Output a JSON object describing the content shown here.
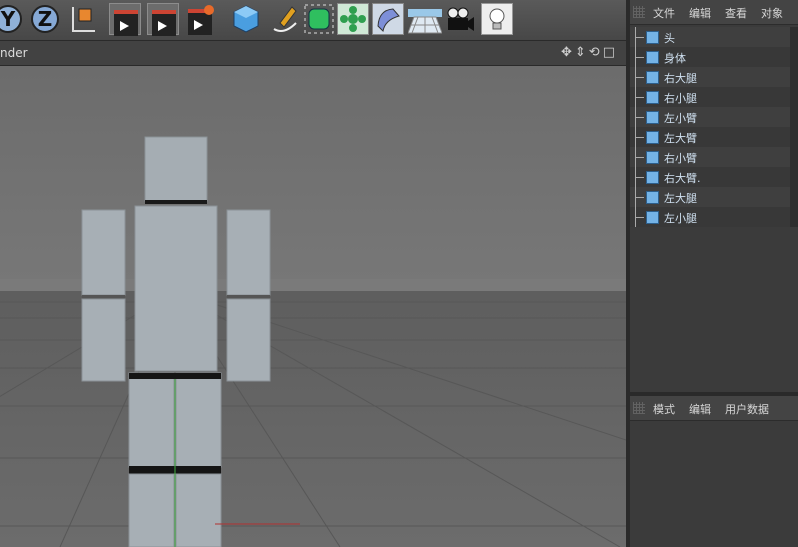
{
  "toolbar": {
    "axis_buttons": [
      {
        "label": "Y"
      },
      {
        "label": "Z"
      }
    ],
    "tools": [
      "coordinate-system-icon",
      "render-view-icon",
      "render-picture-viewer-icon",
      "render-settings-icon",
      "cube-object-icon",
      "spline-pen-icon",
      "subdivision-surface-icon",
      "array-icon",
      "deformer-icon",
      "floor-icon",
      "camera-icon",
      "light-icon"
    ]
  },
  "viewport": {
    "label": "nder"
  },
  "objects_panel": {
    "menu": [
      "文件",
      "编辑",
      "查看",
      "对象"
    ],
    "items": [
      {
        "label": "头"
      },
      {
        "label": "身体"
      },
      {
        "label": "右大腿"
      },
      {
        "label": "右小腿"
      },
      {
        "label": "左小臂"
      },
      {
        "label": "左大臂"
      },
      {
        "label": "右小臂"
      },
      {
        "label": "右大臂."
      },
      {
        "label": "左大腿"
      },
      {
        "label": "左小腿"
      }
    ]
  },
  "attributes_panel": {
    "menu": [
      "模式",
      "编辑",
      "用户数据"
    ]
  },
  "colors": {
    "background": "#3d3d3d",
    "viewport": "#6a6a6a",
    "object_icon": "#74b3e6",
    "label": "#cfe0f0"
  }
}
